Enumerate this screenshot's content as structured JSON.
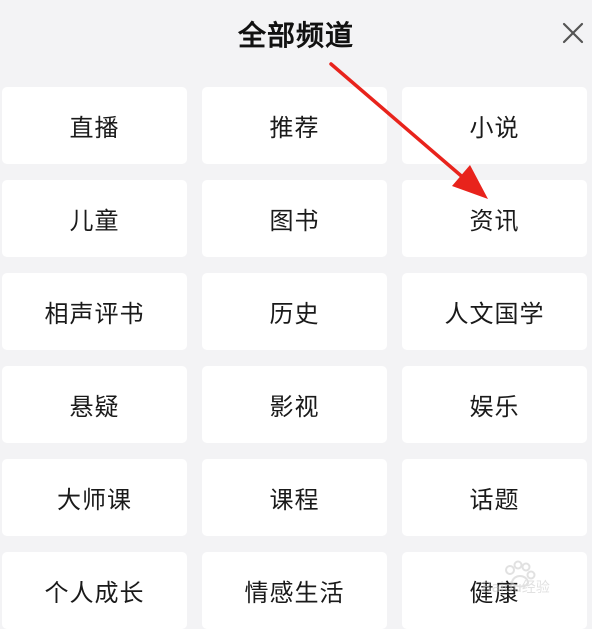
{
  "header": {
    "title": "全部频道",
    "close_icon": "close-icon"
  },
  "channels": [
    {
      "label": "直播"
    },
    {
      "label": "推荐"
    },
    {
      "label": "小说"
    },
    {
      "label": "儿童"
    },
    {
      "label": "图书"
    },
    {
      "label": "资讯"
    },
    {
      "label": "相声评书"
    },
    {
      "label": "历史"
    },
    {
      "label": "人文国学"
    },
    {
      "label": "悬疑"
    },
    {
      "label": "影视"
    },
    {
      "label": "娱乐"
    },
    {
      "label": "大师课"
    },
    {
      "label": "课程"
    },
    {
      "label": "话题"
    },
    {
      "label": "个人成长"
    },
    {
      "label": "情感生活"
    },
    {
      "label": "健康"
    }
  ],
  "colors": {
    "background": "#f3f3f5",
    "tile": "#ffffff",
    "text": "#1a1a1a",
    "annotation_arrow": "#e8231c"
  },
  "watermark": {
    "text": "Baidu经验"
  }
}
